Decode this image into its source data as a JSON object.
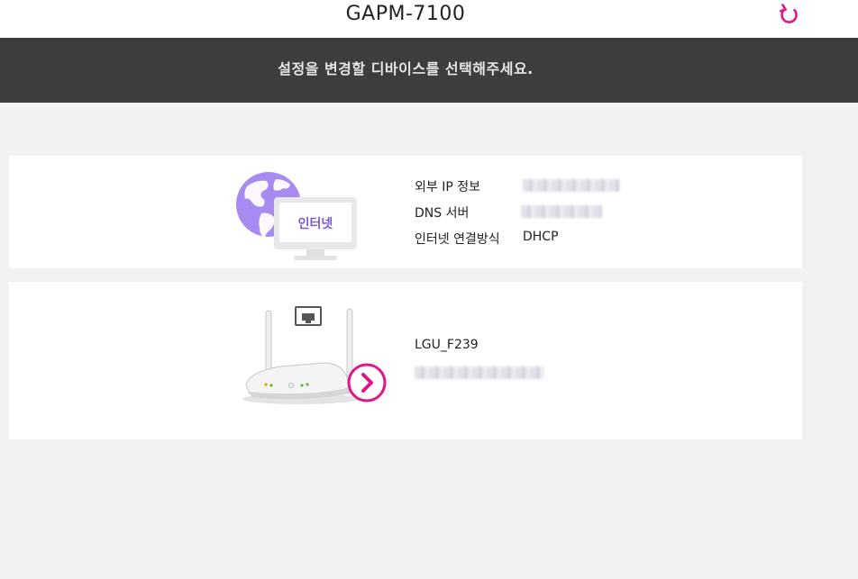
{
  "header": {
    "title": "GAPM-7100",
    "refresh_icon": "refresh-icon",
    "accent_color": "#e0168a"
  },
  "banner": {
    "text": "설정을 변경할 디바이스를 선택해주세요."
  },
  "internet_card": {
    "icon_label": "인터넷",
    "rows": [
      {
        "label": "외부 IP 정보",
        "value": ""
      },
      {
        "label": "DNS 서버",
        "value": ""
      },
      {
        "label": "인터넷 연결방식",
        "value": "DHCP"
      }
    ]
  },
  "router_card": {
    "name": "LGU_F239",
    "arrow_icon": "chevron-right-circle-icon"
  }
}
